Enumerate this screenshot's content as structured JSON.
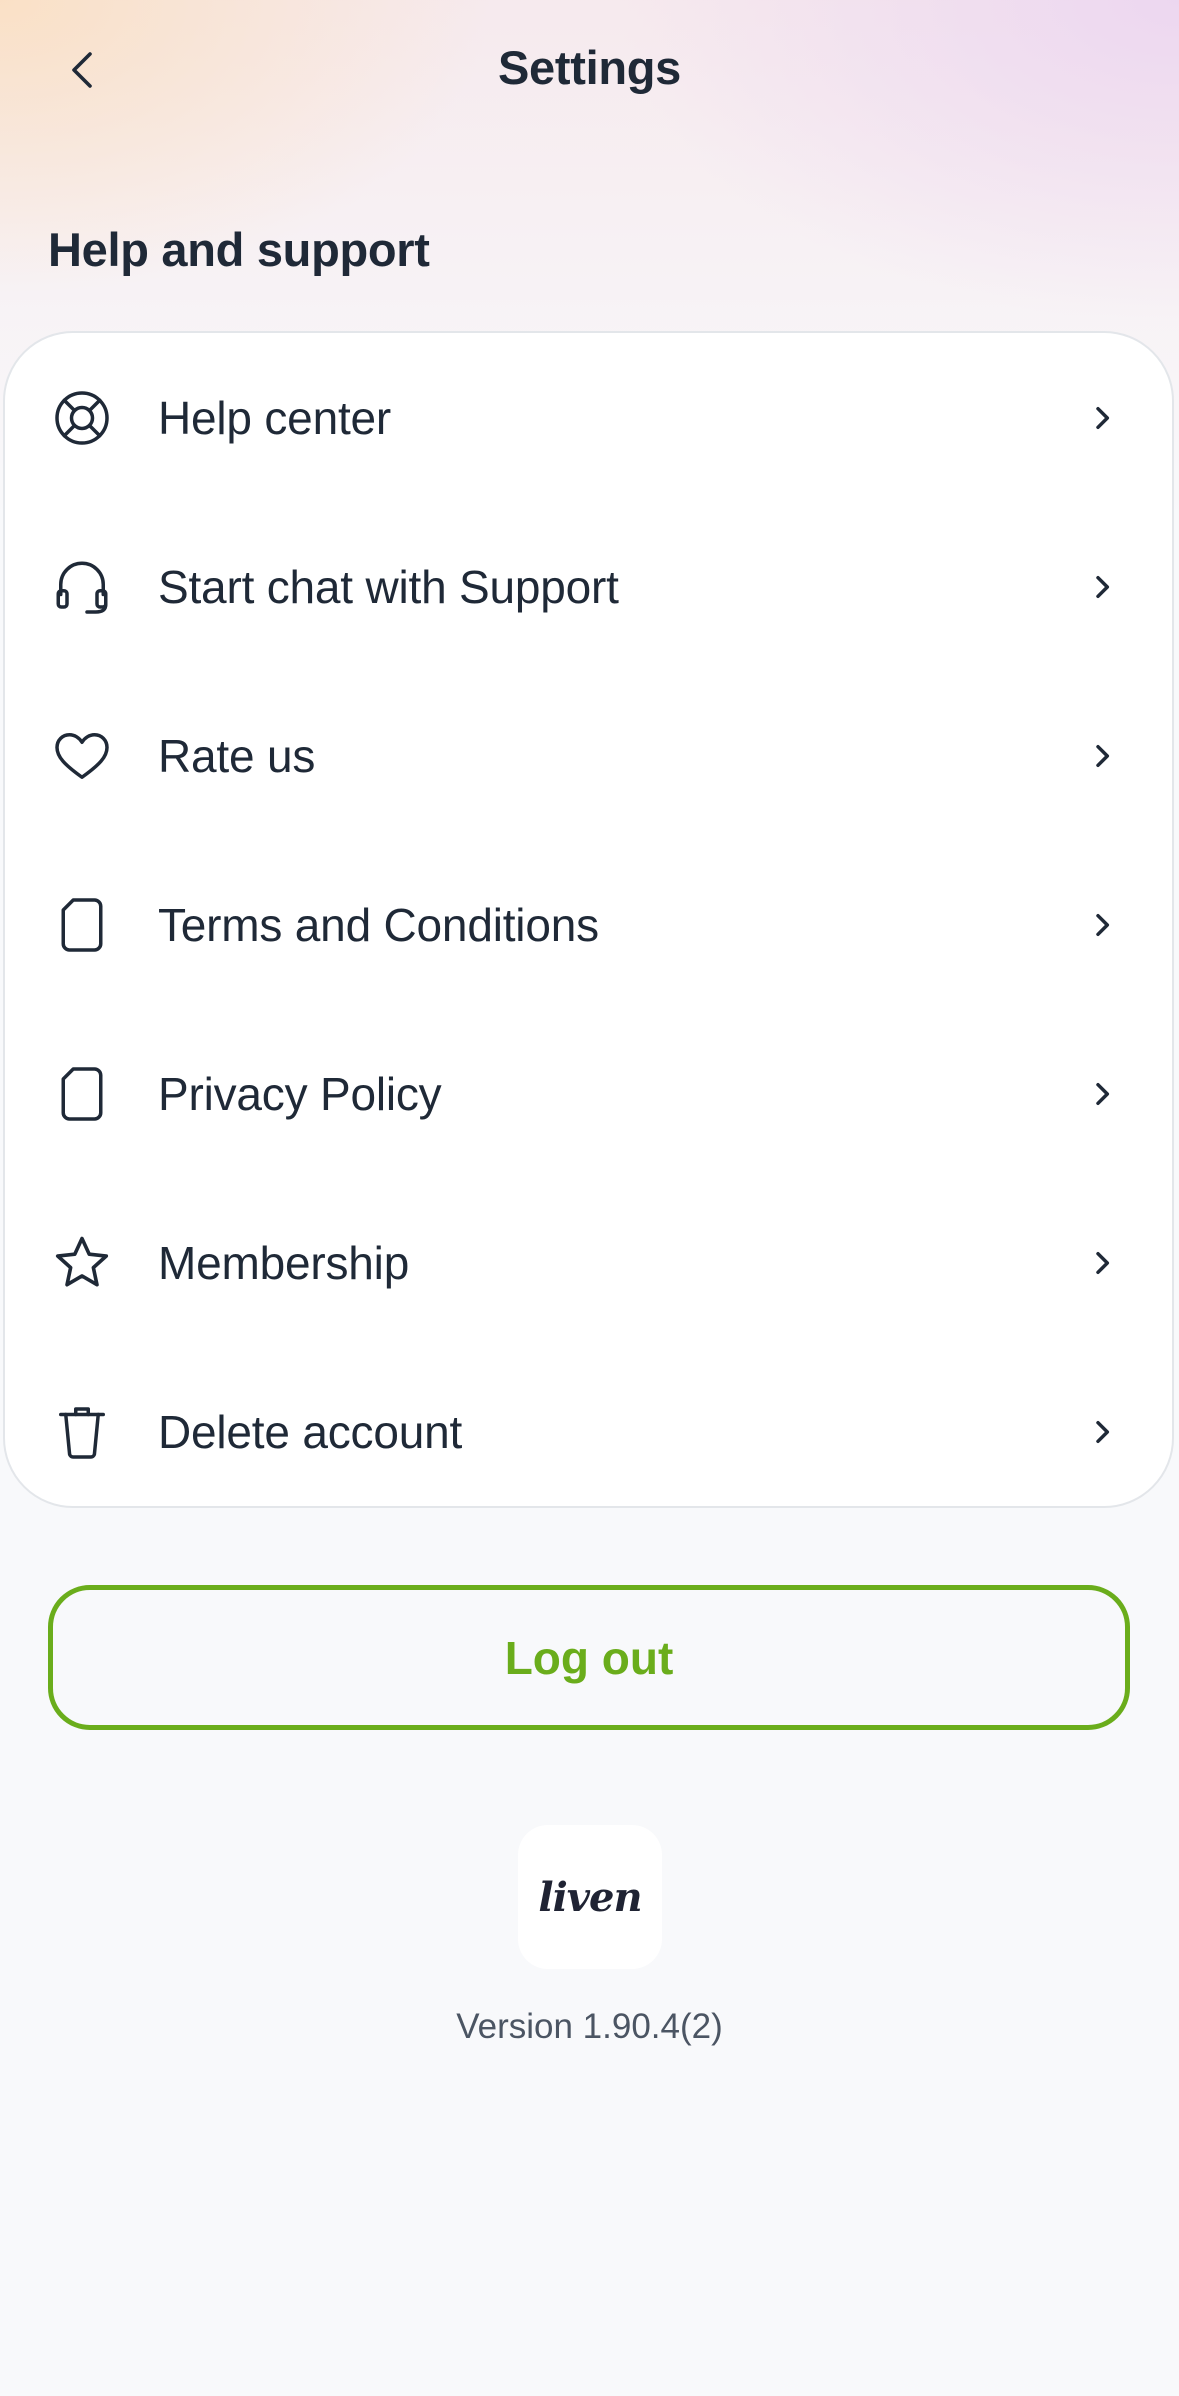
{
  "header": {
    "title": "Settings",
    "back_icon": "chevron-left-icon"
  },
  "section": {
    "title": "Help and support"
  },
  "menu": {
    "items": [
      {
        "id": "help-center",
        "label": "Help center",
        "icon": "lifebuoy-icon"
      },
      {
        "id": "start-chat-support",
        "label": "Start chat with Support",
        "icon": "headphones-icon"
      },
      {
        "id": "rate-us",
        "label": "Rate us",
        "icon": "heart-icon"
      },
      {
        "id": "terms-and-conditions",
        "label": "Terms and Conditions",
        "icon": "document-icon"
      },
      {
        "id": "privacy-policy",
        "label": "Privacy Policy",
        "icon": "document-icon"
      },
      {
        "id": "membership",
        "label": "Membership",
        "icon": "star-icon"
      },
      {
        "id": "delete-account",
        "label": "Delete account",
        "icon": "trash-icon"
      }
    ]
  },
  "logout": {
    "label": "Log out"
  },
  "app": {
    "logo_text": "liven",
    "version": "Version 1.90.4(2)"
  },
  "colors": {
    "accent": "#6aad1b",
    "text": "#1f2937",
    "muted": "#4b5563",
    "card_border": "#e3e6ea",
    "background": "#f8f9fb"
  }
}
